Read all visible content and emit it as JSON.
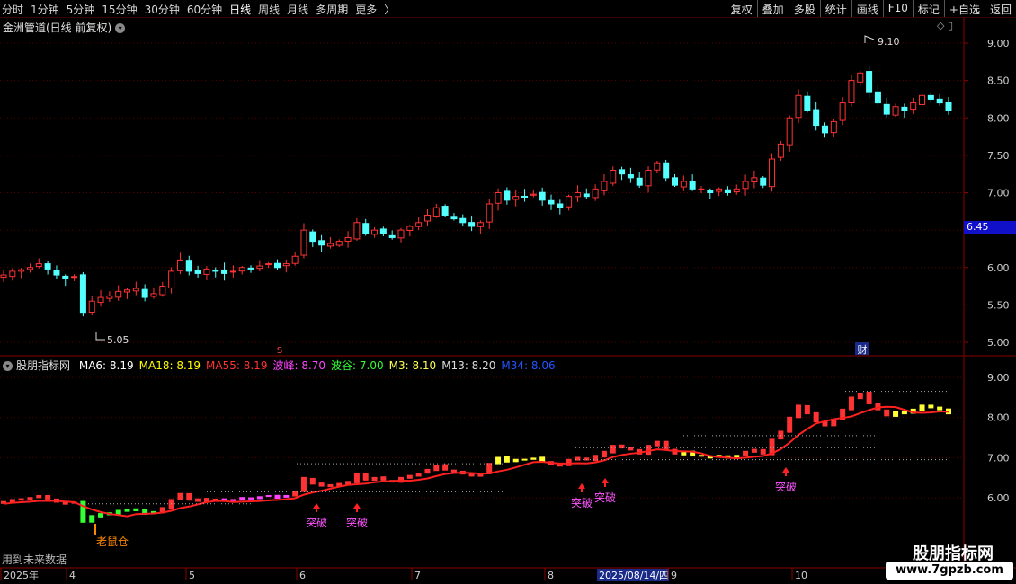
{
  "toolbar": {
    "periods": [
      "分时",
      "1分钟",
      "5分钟",
      "15分钟",
      "30分钟",
      "60分钟",
      "日线",
      "周线",
      "月线",
      "多周期",
      "更多"
    ],
    "active_period": "日线",
    "more_chevron": "〉",
    "tools": [
      "复权",
      "叠加",
      "多股",
      "统计",
      "画线",
      "F10",
      "标记",
      "+自选",
      "返回"
    ]
  },
  "main": {
    "title": "金洲管道(日线 前复权)",
    "current_price": "6.45",
    "high_label": "9.10",
    "low_label": "5.05",
    "marker_s": "S",
    "marker_cai": "财",
    "y_ticks": [
      "9.00",
      "8.50",
      "8.00",
      "7.50",
      "7.00",
      "6.50",
      "6.00",
      "5.50",
      "5.00"
    ]
  },
  "indicator": {
    "name": "股朋指标网",
    "items": [
      {
        "label": "MA6: 8.19",
        "color": "#ffffff"
      },
      {
        "label": "MA18: 8.19",
        "color": "#ffff00"
      },
      {
        "label": "MA55: 8.19",
        "color": "#ff3333"
      },
      {
        "label": "波峰: 8.70",
        "color": "#ff44ff"
      },
      {
        "label": "波谷: 7.00",
        "color": "#33ff33"
      },
      {
        "label": "M3: 8.10",
        "color": "#ffff55"
      },
      {
        "label": "M13: 8.20",
        "color": "#dddddd"
      },
      {
        "label": "M34: 8.06",
        "color": "#2255ff"
      }
    ],
    "y_ticks": [
      "9.00",
      "8.00",
      "7.00",
      "6.00"
    ],
    "signals": {
      "breakout": "突破",
      "mouse": "老鼠仓"
    }
  },
  "xaxis": {
    "labels": [
      "2025年",
      "4",
      "5",
      "6",
      "7",
      "8",
      "2025/08/14/四",
      "9",
      "10"
    ]
  },
  "footer": {
    "note": "用到未来数据",
    "watermark": "股朋指标网",
    "url": "www.7gpzb.com"
  },
  "colors": {
    "up": "#ff3333",
    "down": "#54ffff",
    "grid": "#5a0000",
    "ma": "#ff2020"
  },
  "price_series": [
    5.9,
    5.95,
    5.97,
    6.0,
    6.05,
    5.98,
    5.9,
    5.85,
    5.88,
    5.4,
    5.55,
    5.6,
    5.62,
    5.68,
    5.7,
    5.72,
    5.6,
    5.65,
    5.75,
    5.95,
    6.1,
    5.95,
    5.92,
    5.98,
    5.95,
    5.92,
    5.95,
    6.0,
    5.98,
    6.02,
    6.05,
    6.0,
    6.05,
    6.15,
    6.5,
    6.35,
    6.3,
    6.32,
    6.35,
    6.4,
    6.6,
    6.45,
    6.5,
    6.45,
    6.4,
    6.5,
    6.55,
    6.6,
    6.7,
    6.8,
    6.7,
    6.65,
    6.6,
    6.55,
    6.6,
    6.85,
    7.0,
    6.9,
    6.95,
    6.95,
    6.98,
    6.9,
    6.85,
    6.8,
    6.95,
    7.0,
    6.95,
    7.05,
    7.15,
    7.3,
    7.25,
    7.2,
    7.1,
    7.3,
    7.4,
    7.2,
    7.1,
    7.15,
    7.05,
    7.05,
    7.0,
    7.05,
    7.0,
    7.05,
    7.15,
    7.2,
    7.1,
    7.45,
    7.65,
    8.0,
    8.3,
    8.1,
    7.9,
    7.8,
    7.95,
    8.2,
    8.5,
    8.6,
    8.35,
    8.2,
    8.05,
    8.15,
    8.1,
    8.2,
    8.3,
    8.25,
    8.2,
    8.1
  ]
}
